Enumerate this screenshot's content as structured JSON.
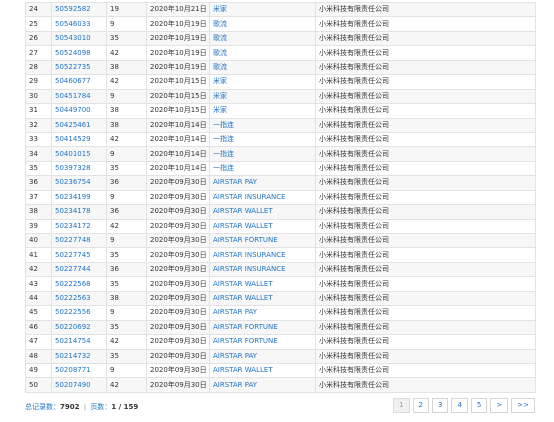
{
  "rows": [
    {
      "no": "24",
      "reg": "50592582",
      "cls": "19",
      "date": "2020年10月21日",
      "mark": "米家",
      "owner": "小米科技有限责任公司"
    },
    {
      "no": "25",
      "reg": "50546033",
      "cls": "9",
      "date": "2020年10月19日",
      "mark": "歌流",
      "owner": "小米科技有限责任公司"
    },
    {
      "no": "26",
      "reg": "50543010",
      "cls": "35",
      "date": "2020年10月19日",
      "mark": "歌流",
      "owner": "小米科技有限责任公司"
    },
    {
      "no": "27",
      "reg": "50524098",
      "cls": "42",
      "date": "2020年10月19日",
      "mark": "歌流",
      "owner": "小米科技有限责任公司"
    },
    {
      "no": "28",
      "reg": "50522735",
      "cls": "38",
      "date": "2020年10月19日",
      "mark": "歌流",
      "owner": "小米科技有限责任公司"
    },
    {
      "no": "29",
      "reg": "50460677",
      "cls": "42",
      "date": "2020年10月15日",
      "mark": "米家",
      "owner": "小米科技有限责任公司"
    },
    {
      "no": "30",
      "reg": "50451784",
      "cls": "9",
      "date": "2020年10月15日",
      "mark": "米家",
      "owner": "小米科技有限责任公司"
    },
    {
      "no": "31",
      "reg": "50449700",
      "cls": "38",
      "date": "2020年10月15日",
      "mark": "米家",
      "owner": "小米科技有限责任公司"
    },
    {
      "no": "32",
      "reg": "50425461",
      "cls": "38",
      "date": "2020年10月14日",
      "mark": "一指连",
      "owner": "小米科技有限责任公司"
    },
    {
      "no": "33",
      "reg": "50414529",
      "cls": "42",
      "date": "2020年10月14日",
      "mark": "一指连",
      "owner": "小米科技有限责任公司"
    },
    {
      "no": "34",
      "reg": "50401015",
      "cls": "9",
      "date": "2020年10月14日",
      "mark": "一指连",
      "owner": "小米科技有限责任公司"
    },
    {
      "no": "35",
      "reg": "50397328",
      "cls": "35",
      "date": "2020年10月14日",
      "mark": "一指连",
      "owner": "小米科技有限责任公司"
    },
    {
      "no": "36",
      "reg": "50236754",
      "cls": "36",
      "date": "2020年09月30日",
      "mark": "AIRSTAR PAY",
      "owner": "小米科技有限责任公司"
    },
    {
      "no": "37",
      "reg": "50234199",
      "cls": "9",
      "date": "2020年09月30日",
      "mark": "AIRSTAR INSURANCE",
      "owner": "小米科技有限责任公司"
    },
    {
      "no": "38",
      "reg": "50234178",
      "cls": "36",
      "date": "2020年09月30日",
      "mark": "AIRSTAR WALLET",
      "owner": "小米科技有限责任公司"
    },
    {
      "no": "39",
      "reg": "50234172",
      "cls": "42",
      "date": "2020年09月30日",
      "mark": "AIRSTAR WALLET",
      "owner": "小米科技有限责任公司"
    },
    {
      "no": "40",
      "reg": "50227748",
      "cls": "9",
      "date": "2020年09月30日",
      "mark": "AIRSTAR FORTUNE",
      "owner": "小米科技有限责任公司"
    },
    {
      "no": "41",
      "reg": "50227745",
      "cls": "35",
      "date": "2020年09月30日",
      "mark": "AIRSTAR INSURANCE",
      "owner": "小米科技有限责任公司"
    },
    {
      "no": "42",
      "reg": "50227744",
      "cls": "36",
      "date": "2020年09月30日",
      "mark": "AIRSTAR INSURANCE",
      "owner": "小米科技有限责任公司"
    },
    {
      "no": "43",
      "reg": "50222568",
      "cls": "35",
      "date": "2020年09月30日",
      "mark": "AIRSTAR WALLET",
      "owner": "小米科技有限责任公司"
    },
    {
      "no": "44",
      "reg": "50222563",
      "cls": "38",
      "date": "2020年09月30日",
      "mark": "AIRSTAR WALLET",
      "owner": "小米科技有限责任公司"
    },
    {
      "no": "45",
      "reg": "50222556",
      "cls": "9",
      "date": "2020年09月30日",
      "mark": "AIRSTAR PAY",
      "owner": "小米科技有限责任公司"
    },
    {
      "no": "46",
      "reg": "50220692",
      "cls": "35",
      "date": "2020年09月30日",
      "mark": "AIRSTAR FORTUNE",
      "owner": "小米科技有限责任公司"
    },
    {
      "no": "47",
      "reg": "50214754",
      "cls": "42",
      "date": "2020年09月30日",
      "mark": "AIRSTAR FORTUNE",
      "owner": "小米科技有限责任公司"
    },
    {
      "no": "48",
      "reg": "50214732",
      "cls": "35",
      "date": "2020年09月30日",
      "mark": "AIRSTAR PAY",
      "owner": "小米科技有限责任公司"
    },
    {
      "no": "49",
      "reg": "50208771",
      "cls": "9",
      "date": "2020年09月30日",
      "mark": "AIRSTAR WALLET",
      "owner": "小米科技有限责任公司"
    },
    {
      "no": "50",
      "reg": "50207490",
      "cls": "42",
      "date": "2020年09月30日",
      "mark": "AIRSTAR PAY",
      "owner": "小米科技有限责任公司"
    }
  ],
  "summary": {
    "total_label": "总记录数：",
    "total_value": "7902",
    "separator": "|",
    "pages_label": "页数：",
    "pages_value": "1 / 159"
  },
  "pager": [
    {
      "label": "1",
      "current": true
    },
    {
      "label": "2",
      "current": false
    },
    {
      "label": "3",
      "current": false
    },
    {
      "label": "4",
      "current": false
    },
    {
      "label": "5",
      "current": false
    },
    {
      "label": ">",
      "current": false
    },
    {
      "label": ">>",
      "current": false
    }
  ],
  "colors": {
    "link": "#1f73c8",
    "border": "#e3e3e3",
    "row_alt": "#f7f7f7"
  }
}
